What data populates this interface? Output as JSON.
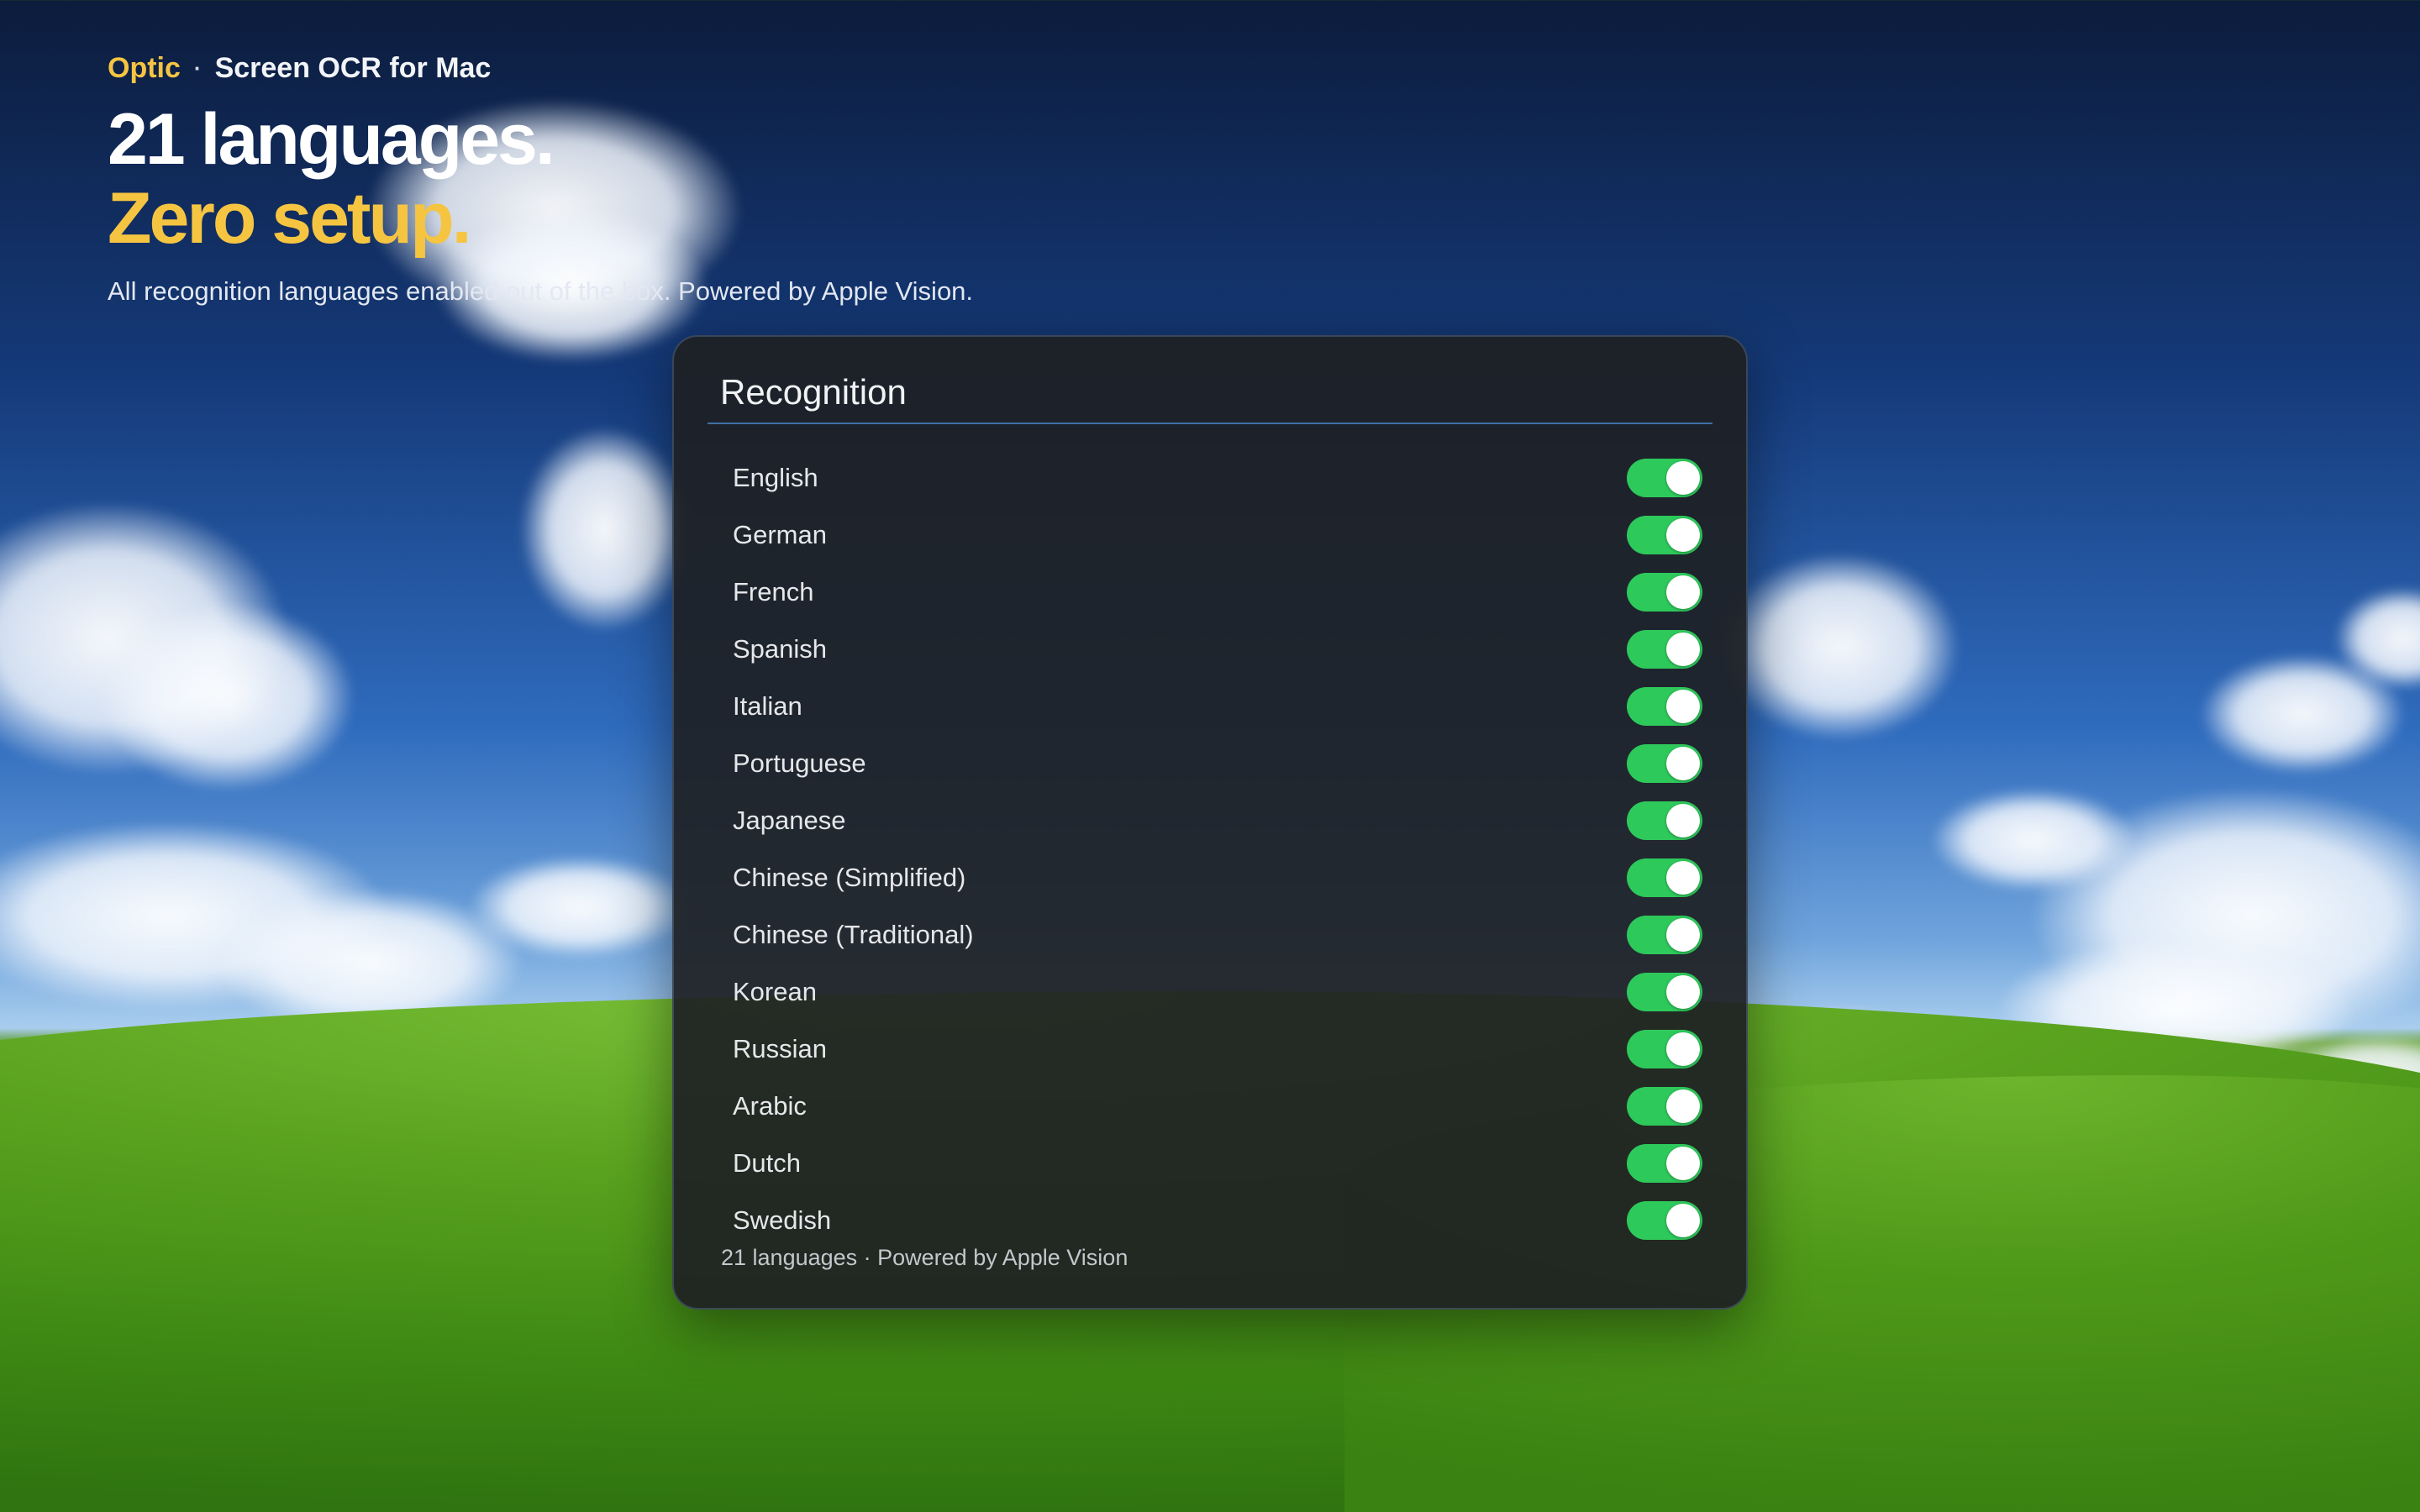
{
  "header": {
    "brand": "Optic",
    "separator": "·",
    "tagline": "Screen OCR for Mac",
    "headline_line1": "21 languages.",
    "headline_line2": "Zero setup.",
    "subtitle": "All recognition languages enabled out of the box. Powered by Apple Vision."
  },
  "panel": {
    "title": "Recognition",
    "languages": [
      {
        "label": "English",
        "enabled": true
      },
      {
        "label": "German",
        "enabled": true
      },
      {
        "label": "French",
        "enabled": true
      },
      {
        "label": "Spanish",
        "enabled": true
      },
      {
        "label": "Italian",
        "enabled": true
      },
      {
        "label": "Portuguese",
        "enabled": true
      },
      {
        "label": "Japanese",
        "enabled": true
      },
      {
        "label": "Chinese (Simplified)",
        "enabled": true
      },
      {
        "label": "Chinese (Traditional)",
        "enabled": true
      },
      {
        "label": "Korean",
        "enabled": true
      },
      {
        "label": "Russian",
        "enabled": true
      },
      {
        "label": "Arabic",
        "enabled": true
      },
      {
        "label": "Dutch",
        "enabled": true
      },
      {
        "label": "Swedish",
        "enabled": true
      }
    ],
    "footer": "21 languages · Powered by Apple Vision"
  },
  "colors": {
    "brand_accent": "#f5c542",
    "toggle_on": "#2ec95b",
    "panel_bg": "#1e2024",
    "divider": "#3e6fa6"
  }
}
